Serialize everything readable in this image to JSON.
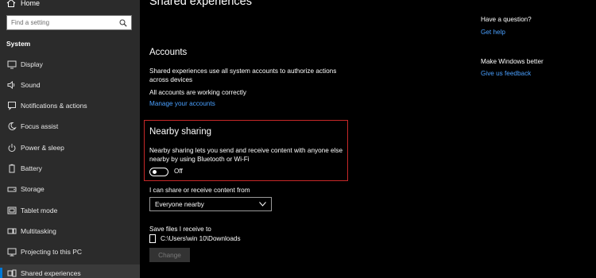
{
  "sidebar": {
    "home_label": "Home",
    "search_placeholder": "Find a setting",
    "section_title": "System",
    "items": [
      {
        "label": "Display",
        "icon": "monitor-icon"
      },
      {
        "label": "Sound",
        "icon": "speaker-icon"
      },
      {
        "label": "Notifications & actions",
        "icon": "notification-icon"
      },
      {
        "label": "Focus assist",
        "icon": "moon-icon"
      },
      {
        "label": "Power & sleep",
        "icon": "power-icon"
      },
      {
        "label": "Battery",
        "icon": "battery-icon"
      },
      {
        "label": "Storage",
        "icon": "storage-icon"
      },
      {
        "label": "Tablet mode",
        "icon": "tablet-icon"
      },
      {
        "label": "Multitasking",
        "icon": "multitasking-icon"
      },
      {
        "label": "Projecting to this PC",
        "icon": "projecting-icon"
      },
      {
        "label": "Shared experiences",
        "icon": "shared-experiences-icon",
        "selected": true
      }
    ]
  },
  "main": {
    "title": "Shared experiences",
    "accounts": {
      "heading": "Accounts",
      "description": "Shared experiences use all system accounts to authorize actions across devices",
      "status": "All accounts are working correctly",
      "link": "Manage your accounts"
    },
    "nearby": {
      "heading": "Nearby sharing",
      "description": "Nearby sharing lets you send and receive content with anyone else nearby by using Bluetooth or Wi-Fi",
      "toggle_state": "Off",
      "share_label": "I can share or receive content from",
      "share_value": "Everyone nearby",
      "save_label": "Save files I receive to",
      "save_path": "C:\\Users\\win 10\\Downloads",
      "change_button": "Change"
    }
  },
  "right_panel": {
    "question_heading": "Have a question?",
    "help_link": "Get help",
    "better_heading": "Make Windows better",
    "feedback_link": "Give us feedback"
  },
  "colors": {
    "accent": "#0078d7",
    "link": "#4aa0ff",
    "highlight_box": "#c62828"
  }
}
